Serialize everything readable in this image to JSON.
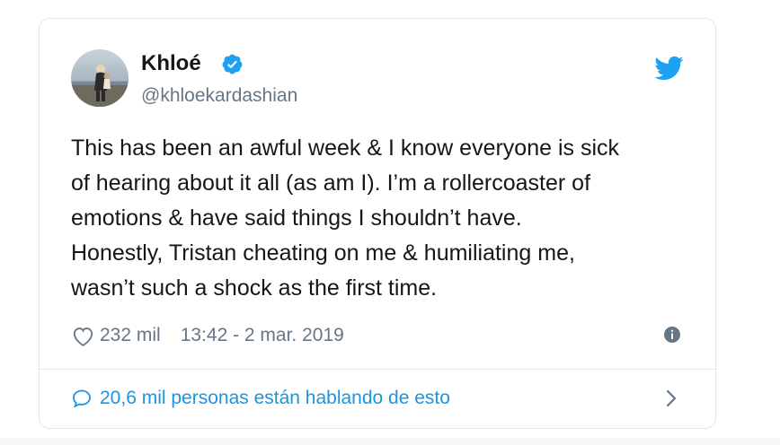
{
  "author": {
    "display_name": "Khloé",
    "handle": "@khloekardashian",
    "verified": true
  },
  "tweet": {
    "text": "This has been an awful week & I know everyone is sick\nof hearing about it all (as am I). I’m a rollercoaster of\nemotions & have said things I shouldn’t have.\nHonestly, Tristan cheating on me & humiliating me,\nwasn’t such a shock as the first time."
  },
  "meta": {
    "likes": "232 mil",
    "timestamp": "13:42 - 2 mar. 2019"
  },
  "conversation": {
    "label": "20,6 mil personas están hablando de esto"
  },
  "icons": {
    "verified": "verified-badge-icon",
    "brand": "twitter-bird-icon",
    "like": "heart-icon",
    "info": "info-icon",
    "reply": "comment-icon",
    "more": "chevron-right-icon"
  },
  "colors": {
    "twitter_blue": "#1da1f2",
    "link_blue": "#1b95e0",
    "text_primary": "#14171a",
    "text_secondary": "#657786",
    "border": "#e1e8ed"
  }
}
